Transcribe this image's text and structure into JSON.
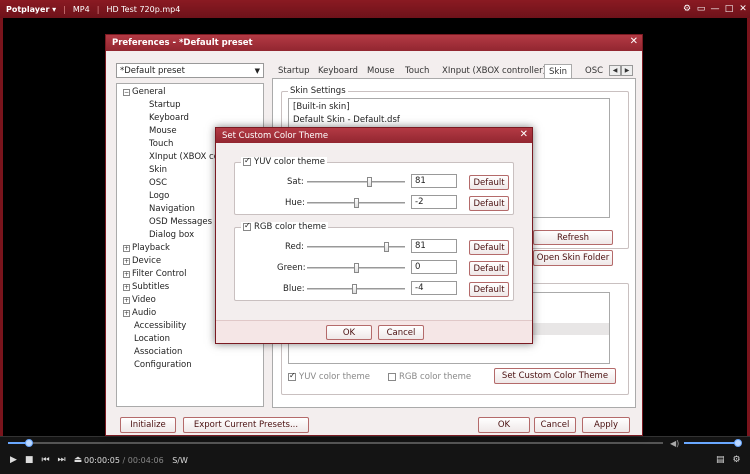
{
  "player": {
    "app_name": "Potplayer",
    "format": "MP4",
    "file_title": "HD Test 720p.mp4",
    "time_current": "00:00:05",
    "time_total": "00:04:06",
    "sw_label": "S/W"
  },
  "preferences": {
    "title": "Preferences - *Default preset",
    "preset": "*Default preset",
    "tree": {
      "general": "General",
      "general_children": [
        "Startup",
        "Keyboard",
        "Mouse",
        "Touch",
        "XInput (XBOX con",
        "Skin",
        "OSC",
        "Logo",
        "Navigation",
        "OSD Messages",
        "Dialog box"
      ],
      "others_expandable": [
        "Playback",
        "Device",
        "Filter Control",
        "Subtitles",
        "Video",
        "Audio"
      ],
      "others_plain": [
        "Accessibility",
        "Location",
        "Association",
        "Configuration"
      ]
    },
    "tabs": [
      "Startup",
      "Keyboard",
      "Mouse",
      "Touch",
      "XInput (XBOX controller)",
      "Skin",
      "OSC"
    ],
    "skin_settings_label": "Skin Settings",
    "skin_list": [
      "[Built-in skin]",
      "Default Skin - Default.dsf"
    ],
    "refresh": "Refresh",
    "open_skin_folder": "Open Skin Folder",
    "yuv_color_theme": "YUV color theme",
    "rgb_color_theme": "RGB color theme",
    "set_custom_color_theme": "Set Custom Color Theme",
    "initialize": "Initialize",
    "export_presets": "Export Current Presets...",
    "ok": "OK",
    "cancel": "Cancel",
    "apply": "Apply"
  },
  "color_dialog": {
    "title": "Set Custom Color Theme",
    "yuv_label": "YUV color theme",
    "yuv_checked": true,
    "sat_label": "Sat:",
    "sat_value": "81",
    "hue_label": "Hue:",
    "hue_value": "-2",
    "rgb_label": "RGB color theme",
    "rgb_checked": true,
    "red_label": "Red:",
    "red_value": "81",
    "green_label": "Green:",
    "green_value": "0",
    "blue_label": "Blue:",
    "blue_value": "-4",
    "default": "Default",
    "ok": "OK",
    "cancel": "Cancel"
  },
  "colors": {
    "accent": "#922630",
    "title_bar": "#7a141c"
  }
}
